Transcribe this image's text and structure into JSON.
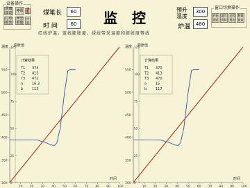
{
  "device_panel": {
    "title": "设备操作",
    "buttons": [
      "风扇启动",
      "停泵",
      "打印报告",
      "声光报警",
      "计量",
      "清零"
    ]
  },
  "monitor": {
    "coal_length_label": "煤笔长",
    "coal_length_value": "60",
    "time_label": "时 间",
    "time_value": "60",
    "title": "监  控",
    "preheat_label_1": "预升",
    "preheat_label_2": "温度",
    "preheat_value": "300",
    "furnace_temp_label": "炉温",
    "furnace_temp_value": "480"
  },
  "window_panel": {
    "title": "窗口切换操作",
    "buttons": [
      "开始测试",
      "填写资料",
      "试验报告",
      "数据查询"
    ]
  },
  "legend_text": "红线炉温，蓝线膨胀度，绿线带采温度和膨胀度等线",
  "colors": {
    "furnace_temp": "#c0392b",
    "expansion": "#3b4fb3",
    "reference": "#3aa83a"
  },
  "charts": [
    {
      "y_left_label": "温度",
      "y_right_label": "膨胀值",
      "x_label": "时间",
      "result_title": "计算结果",
      "results": [
        [
          "T1",
          "374"
        ],
        [
          "T2",
          "413"
        ],
        [
          "T3",
          "472"
        ],
        [
          "a",
          "16.3"
        ],
        [
          "b",
          "115"
        ]
      ],
      "left_ticks": [
        "300",
        "350",
        "400",
        "450",
        "500",
        "550"
      ],
      "right_ticks": [
        "0",
        "25",
        "50",
        "75",
        "100",
        "125"
      ],
      "x_ticks": [
        "10",
        "20",
        "30",
        "40",
        "50",
        "60",
        "70",
        "80",
        "90",
        "100"
      ]
    },
    {
      "y_left_label": "温度",
      "y_right_label": "膨胀值",
      "x_label": "时间",
      "result_title": "计算结果",
      "results": [
        [
          "T1",
          "370"
        ],
        [
          "T2",
          "413"
        ],
        [
          "T3",
          "470"
        ],
        [
          "a",
          "15"
        ],
        [
          "b",
          "117"
        ]
      ],
      "left_ticks": [
        "300",
        "350",
        "400",
        "450",
        "500",
        "550"
      ],
      "right_ticks": [
        "0",
        "25",
        "50",
        "75",
        "100",
        "125"
      ],
      "x_ticks": [
        "10",
        "20",
        "30",
        "40",
        "50",
        "60",
        "70",
        "80",
        "90",
        "100"
      ]
    }
  ],
  "chart_data": [
    {
      "type": "line",
      "xlim": [
        0,
        100
      ],
      "ylim_left": [
        300,
        600
      ],
      "ylim_right": [
        0,
        125
      ],
      "series": [
        {
          "x": [
            0,
            100
          ],
          "y": [
            300,
            600
          ]
        },
        {
          "x": [
            0,
            100
          ],
          "y": [
            300,
            600
          ]
        },
        {
          "x": [
            0,
            25,
            33,
            38,
            41,
            43,
            46,
            50,
            53,
            55,
            60
          ],
          "y": [
            394,
            394,
            388,
            383,
            382,
            388,
            420,
            500,
            548,
            550,
            550
          ]
        }
      ]
    },
    {
      "type": "line",
      "xlim": [
        0,
        100
      ],
      "ylim_left": [
        300,
        600
      ],
      "ylim_right": [
        0,
        125
      ],
      "series": [
        {
          "x": [
            0,
            100
          ],
          "y": [
            300,
            600
          ]
        },
        {
          "x": [
            0,
            100
          ],
          "y": [
            300,
            600
          ]
        },
        {
          "x": [
            0,
            25,
            33,
            38,
            41,
            43,
            46,
            50,
            53,
            55,
            60
          ],
          "y": [
            394,
            394,
            388,
            383,
            382,
            388,
            420,
            500,
            548,
            550,
            550
          ]
        }
      ]
    }
  ]
}
